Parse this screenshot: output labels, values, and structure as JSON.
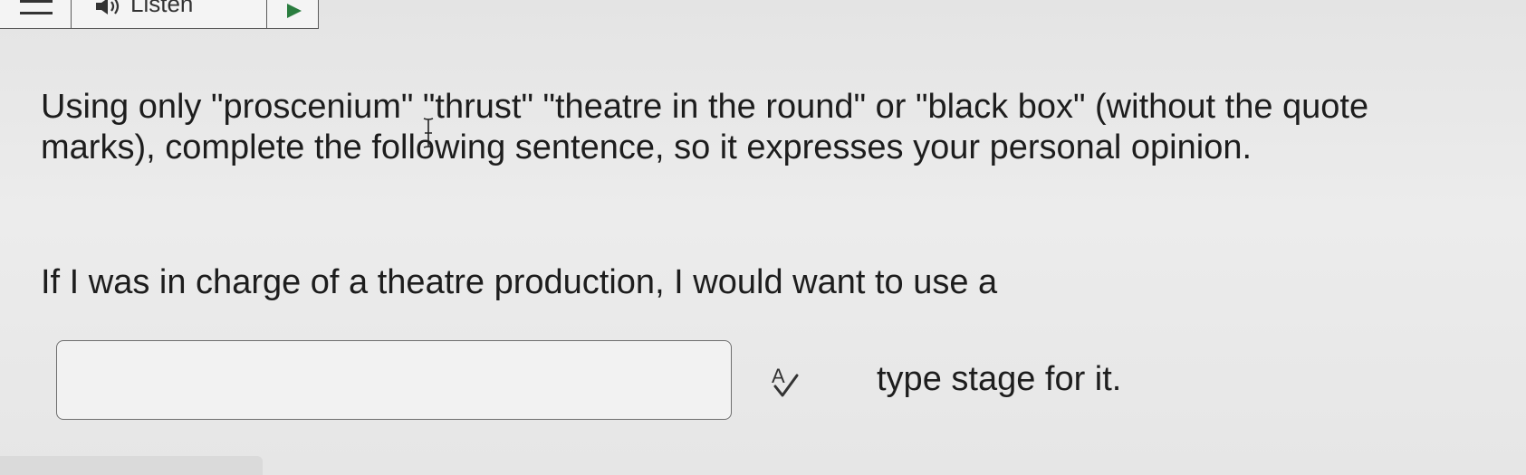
{
  "toolbar": {
    "menu_icon": "hamburger-menu-icon",
    "listen_label": "Listen",
    "speaker_icon": "speaker-icon",
    "play_icon": "play-icon"
  },
  "question": {
    "instructions": "Using only \"proscenium\" \"thrust\" \"theatre in the round\" or \"black box\" (without the quote marks), complete the following sentence, so it expresses your personal opinion.",
    "sentence_start": "If I was in charge of a theatre production, I would want to use a",
    "answer": {
      "value": "",
      "placeholder": ""
    },
    "spellcheck_icon": "spellcheck-icon",
    "sentence_end": "type stage for it."
  },
  "colors": {
    "background": "#e7e7e7",
    "text": "#1d1d1d",
    "play_accent": "#2a7d3f",
    "border": "#6e6e6e"
  }
}
